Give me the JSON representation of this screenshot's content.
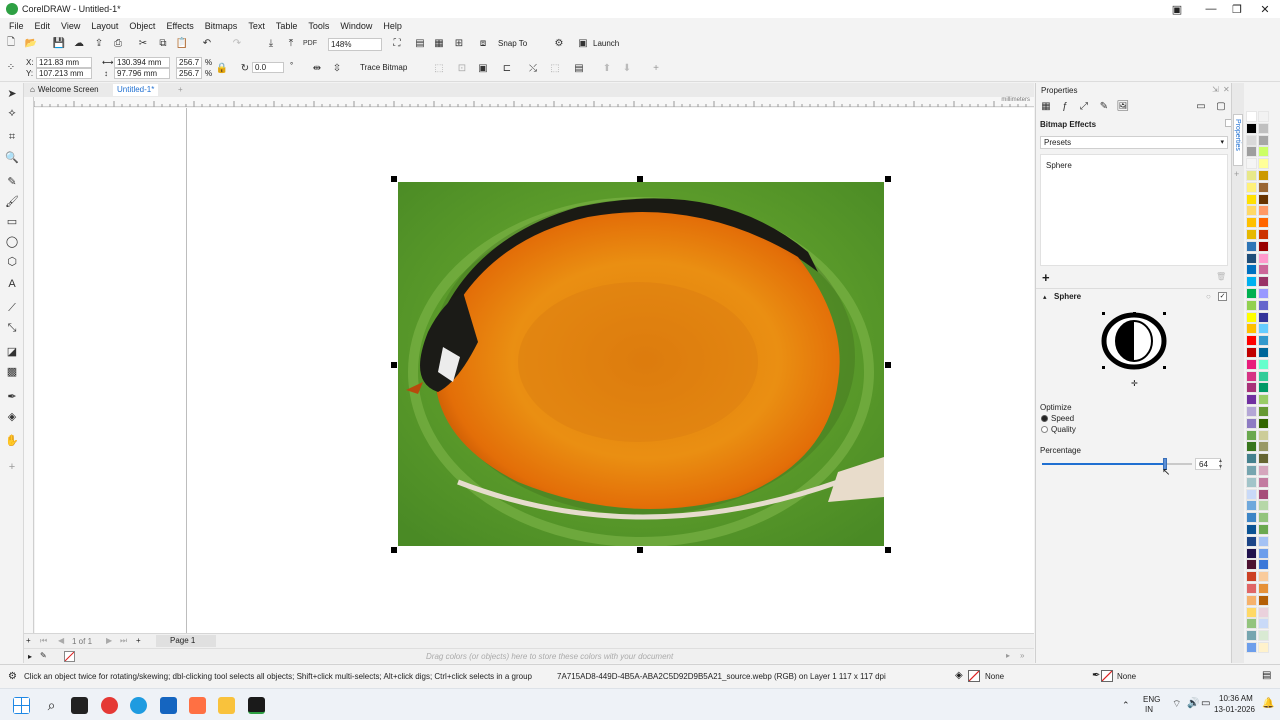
{
  "window": {
    "title": "CorelDRAW - Untitled-1*"
  },
  "menu": [
    "File",
    "Edit",
    "View",
    "Layout",
    "Object",
    "Effects",
    "Bitmaps",
    "Text",
    "Table",
    "Tools",
    "Window",
    "Help"
  ],
  "toolbar": {
    "zoom": "148%",
    "snap_to": "Snap To",
    "launch": "Launch"
  },
  "property_bar": {
    "x": "121.83 mm",
    "y": "107.213 mm",
    "width": "130.394 mm",
    "height": "97.796 mm",
    "scale_x": "256.7",
    "scale_y": "256.7",
    "percent": "%",
    "rotation": "0.0",
    "trace_bitmap": "Trace Bitmap"
  },
  "tabs": {
    "welcome": "Welcome Screen",
    "doc": "Untitled-1*"
  },
  "ruler": {
    "unit": "millimeters"
  },
  "page_nav": {
    "count": "1 of 1",
    "page_tab": "Page 1"
  },
  "color_tray": {
    "hint": "Drag colors (or objects) here to store these colors with your document"
  },
  "docker": {
    "title": "Properties",
    "section": "Bitmap Effects",
    "presets_label": "Presets",
    "preset_item": "Sphere",
    "effect_name": "Sphere",
    "optimize_label": "Optimize",
    "speed": "Speed",
    "quality": "Quality",
    "percentage_label": "Percentage",
    "percentage_value": "64",
    "percentage_fraction": 0.82,
    "side_tab": "Properties"
  },
  "status": {
    "hint": "Click an object twice for rotating/skewing; dbl-clicking tool selects all objects; Shift+click multi-selects; Alt+click digs; Ctrl+click selects in a group",
    "object_info": "7A715AD8-449D-4B5A-ABA2C5D92D9B5A21_source.webp (RGB) on Layer 1  117 x 117 dpi",
    "fill": "None",
    "outline": "None"
  },
  "taskbar": {
    "lang": "ENG",
    "region": "IN",
    "time": "10:36 AM",
    "date": "13-01-2026"
  },
  "colors": {
    "accent": "#1f6fd1",
    "selection": "#000000"
  }
}
